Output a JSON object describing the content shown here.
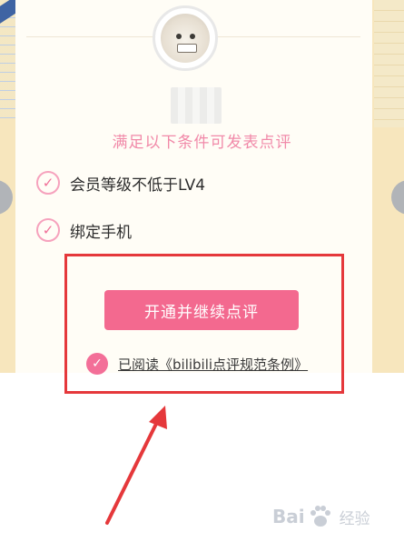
{
  "conditions": {
    "title": "满足以下条件可发表点评",
    "items": [
      {
        "label": "会员等级不低于LV4"
      },
      {
        "label": "绑定手机"
      }
    ]
  },
  "actions": {
    "primary_label": "开通并继续点评",
    "agreement_text": "已阅读《bilibili点评规范条例》",
    "agreement_checked": true
  },
  "icons": {
    "check": "check-icon",
    "avatar": "avatar-image"
  },
  "colors": {
    "accent": "#f3698f",
    "title_pink": "#f18aa9",
    "highlight_red": "#e5383b"
  },
  "watermark": {
    "brand_a": "Bai",
    "brand_b": "经验"
  }
}
